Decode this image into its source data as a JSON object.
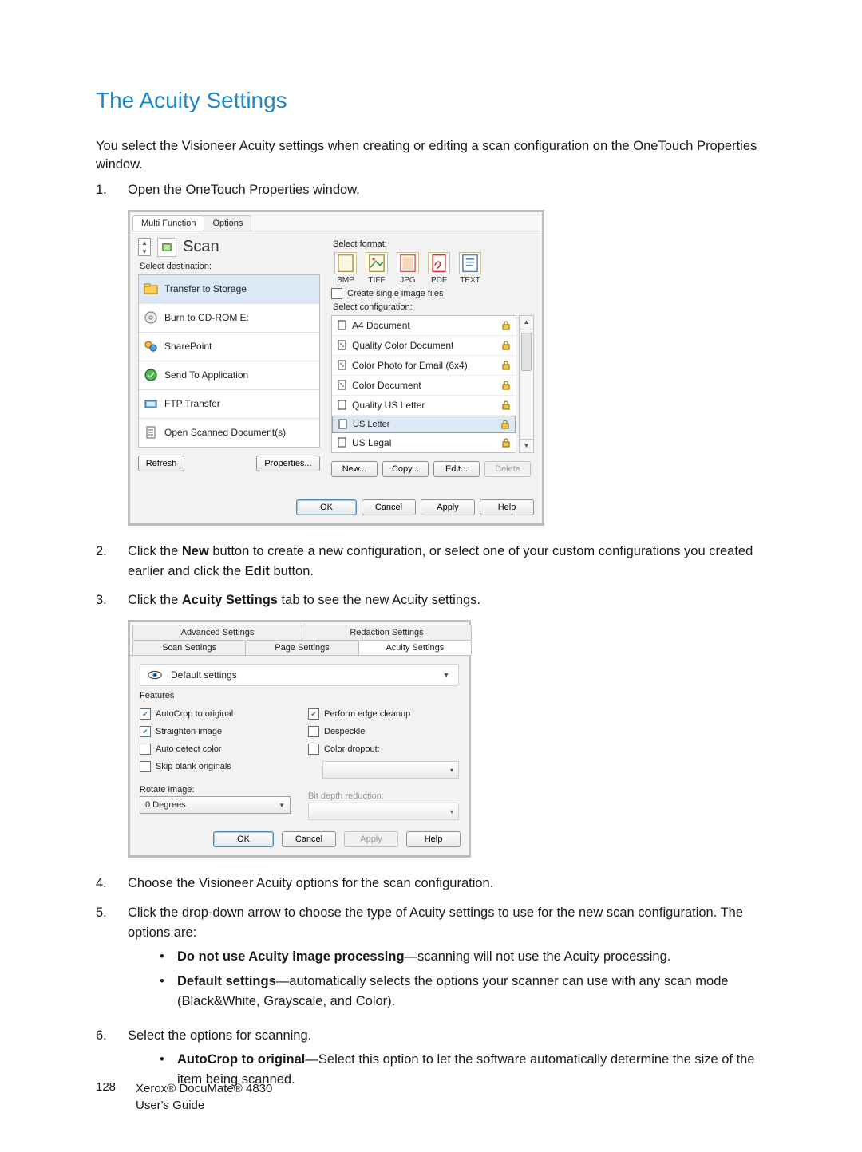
{
  "heading": "The Acuity Settings",
  "intro": "You select the Visioneer Acuity settings when creating or editing a scan configuration on the OneTouch Properties window.",
  "steps": {
    "s1": {
      "num": "1.",
      "text": "Open the OneTouch Properties window."
    },
    "s2": {
      "num": "2.",
      "pre": "Click the ",
      "b1": "New",
      "mid": " button to create a new configuration, or select one of your custom configurations you created earlier and click the ",
      "b2": "Edit",
      "post": " button."
    },
    "s3": {
      "num": "3.",
      "pre": "Click the ",
      "b": "Acuity Settings",
      "post": " tab to see the new Acuity settings."
    },
    "s4": {
      "num": "4.",
      "text": "Choose the Visioneer Acuity options for the scan configuration."
    },
    "s5": {
      "num": "5.",
      "text": "Click the drop-down arrow to choose the type of Acuity settings to use for the new scan configuration. The options are:"
    },
    "s6": {
      "num": "6.",
      "text": "Select the options for scanning."
    }
  },
  "step5_opts": {
    "a": {
      "b": "Do not use Acuity image processing",
      "t": "—scanning will not use the Acuity processing."
    },
    "b": {
      "b": "Default settings",
      "t": "—automatically selects the options your scanner can use with any scan mode (Black&White, Grayscale, and Color)."
    }
  },
  "step6_opts": {
    "a": {
      "b": "AutoCrop to original",
      "t": "—Select this option to let the software automatically determine the size of the item being scanned."
    }
  },
  "shot1": {
    "tabs": {
      "a": "Multi Function",
      "b": "Options"
    },
    "scan": "Scan",
    "sel_dest": "Select destination:",
    "dest": [
      "Transfer to Storage",
      "Burn to CD-ROM  E:",
      "SharePoint",
      "Send To Application",
      "FTP Transfer",
      "Open Scanned Document(s)"
    ],
    "sel_fmt": "Select format:",
    "fmts": [
      "BMP",
      "TIFF",
      "JPG",
      "PDF",
      "TEXT"
    ],
    "create_single": "Create single image files",
    "sel_cfg": "Select configuration:",
    "cfgs": [
      "A4 Document",
      "Quality Color Document",
      "Color Photo for Email (6x4)",
      "Color Document",
      "Quality US Letter",
      "US Letter",
      "US Legal"
    ],
    "btns": {
      "refresh": "Refresh",
      "props": "Properties...",
      "new": "New...",
      "copy": "Copy...",
      "edit": "Edit...",
      "del": "Delete",
      "ok": "OK",
      "cancel": "Cancel",
      "apply": "Apply",
      "help": "Help"
    }
  },
  "shot2": {
    "tabs": {
      "adv": "Advanced Settings",
      "red": "Redaction Settings",
      "scan": "Scan Settings",
      "page": "Page Settings",
      "acuity": "Acuity Settings"
    },
    "preset": "Default settings",
    "features": "Features",
    "left": [
      "AutoCrop to original",
      "Straighten image",
      "Auto detect color",
      "Skip blank originals"
    ],
    "right": [
      "Perform edge cleanup",
      "Despeckle",
      "Color dropout:"
    ],
    "rotate_lbl": "Rotate image:",
    "rotate_val": "0 Degrees",
    "bit_lbl": "Bit depth reduction:",
    "btns": {
      "ok": "OK",
      "cancel": "Cancel",
      "apply": "Apply",
      "help": "Help"
    }
  },
  "footer": {
    "page": "128",
    "l1": "Xerox® DocuMate® 4830",
    "l2": "User's Guide"
  }
}
